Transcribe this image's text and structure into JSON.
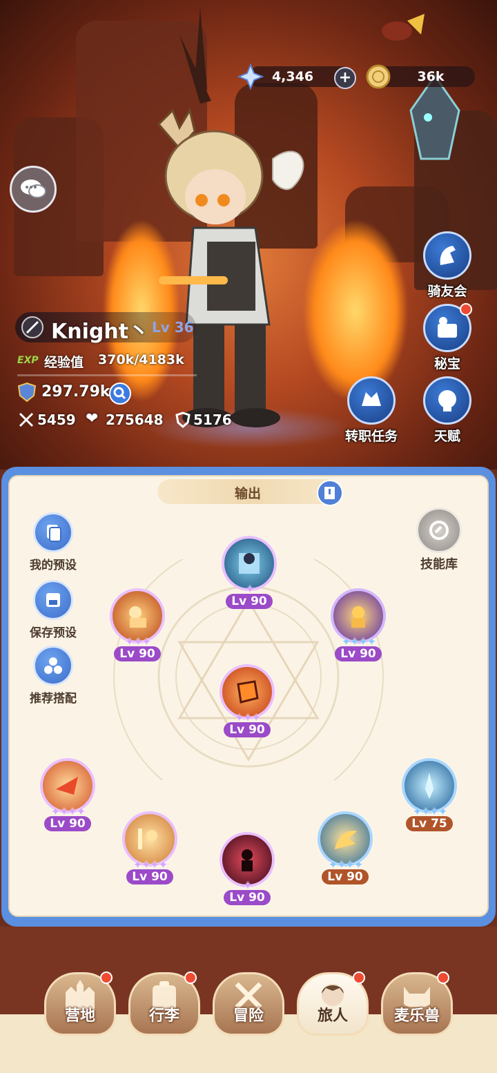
{
  "currency": {
    "gems": "4,346",
    "coins": "36k"
  },
  "character": {
    "name": "Knight丶",
    "level": "Lv 36",
    "exp_tag": "EXP",
    "exp_label": "经验值",
    "exp_value": "370k/4183k",
    "power": "297.79k",
    "attack": "5459",
    "hp": "275648",
    "defense": "5176"
  },
  "side_buttons": {
    "riders": "骑友会",
    "treasure": "秘宝",
    "job_quest": "转职任务",
    "talent": "天赋"
  },
  "panel": {
    "tab_label": "输出",
    "my_presets": "我的预设",
    "save_preset": "保存预设",
    "recommended": "推荐搭配",
    "skill_library": "技能库"
  },
  "skills": [
    {
      "level": "Lv 90",
      "stars": "✦"
    },
    {
      "level": "Lv 90",
      "stars": "✦✦✦"
    },
    {
      "level": "Lv 90",
      "stars": "✦✦✦✦"
    },
    {
      "level": "Lv 90",
      "stars": "✦✦✦"
    },
    {
      "level": "Lv 90",
      "stars": "✦✦✦✦"
    },
    {
      "level": "Lv 75",
      "stars": "✦✦✦✦"
    },
    {
      "level": "Lv 90",
      "stars": "✦✦✦✦"
    },
    {
      "level": "Lv 90",
      "stars": "✦"
    },
    {
      "level": "Lv 90",
      "stars": "✦✦✦✦"
    }
  ],
  "nav": {
    "camp": "营地",
    "bag": "行李",
    "adventure": "冒险",
    "traveler": "旅人",
    "pets": "麦乐兽"
  },
  "colors": {
    "panel_border": "#5b8fe0",
    "panel_bg": "#fbf4e6",
    "level_badge": "#b0552a",
    "level_badge_purple": "#9b4ac8",
    "notification": "#ef4b33"
  }
}
